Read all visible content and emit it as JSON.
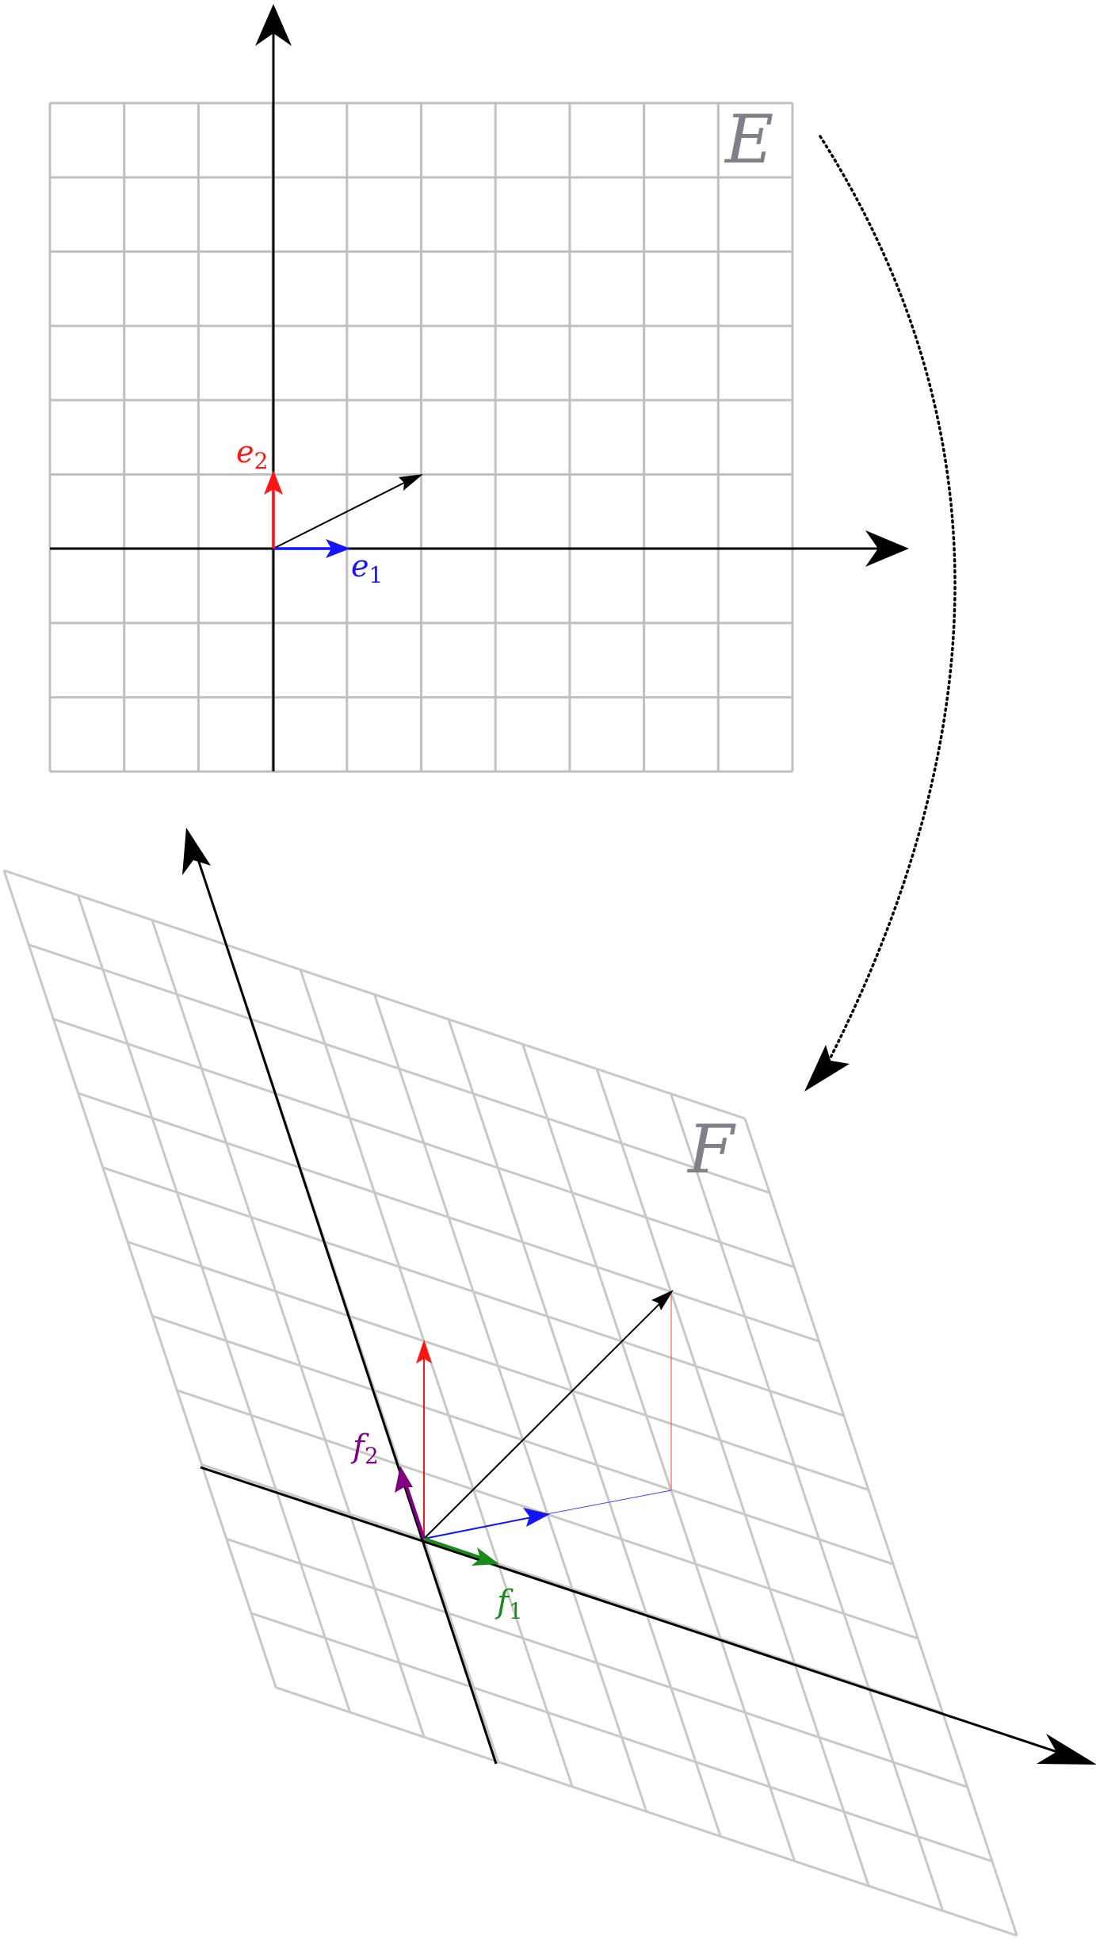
{
  "top_panel": {
    "space_label": "E",
    "basis_1_label": "e",
    "basis_1_sub": "1",
    "basis_2_label": "e",
    "basis_2_sub": "2",
    "colors": {
      "grid": "#c0c0c0",
      "axis": "#000000",
      "e1": "#1414ff",
      "e2": "#ff1414",
      "vector": "#000000",
      "label": "#808088"
    }
  },
  "bottom_panel": {
    "space_label": "F",
    "basis_1_label": "f",
    "basis_1_sub": "1",
    "basis_2_label": "f",
    "basis_2_sub": "2",
    "colors": {
      "grid": "#c8c8c8",
      "axis": "#000000",
      "f1": "#1a8a1a",
      "f2": "#800080",
      "image_e1": "#1414ff",
      "image_e2": "#ff1414",
      "vector": "#000000",
      "label": "#808088"
    }
  },
  "mapping_arrow": {
    "style": "dotted",
    "color": "#000000"
  }
}
